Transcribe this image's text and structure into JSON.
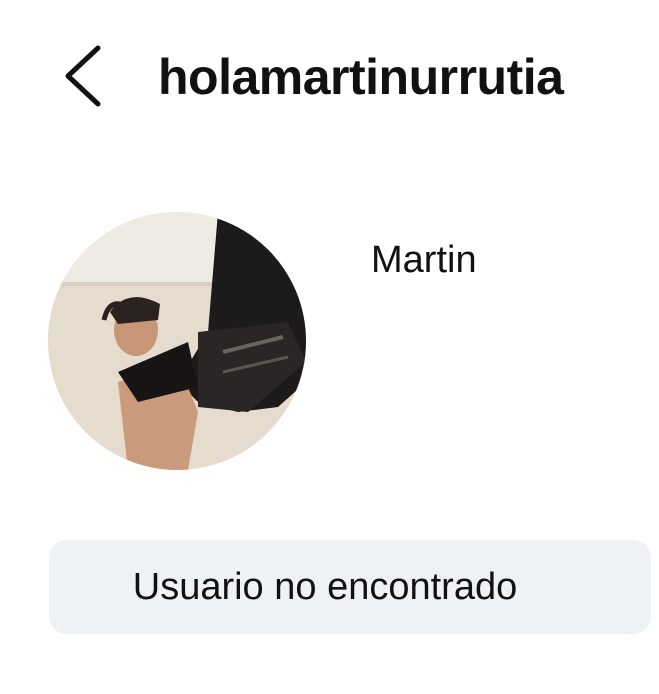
{
  "header": {
    "back_icon": "chevron-left-icon",
    "username": "holamartinurrutia"
  },
  "profile": {
    "avatar_icon": "profile-photo",
    "display_name": "Martin"
  },
  "status": {
    "message": "Usuario no encontrado",
    "background_color": "#eff2f5"
  }
}
